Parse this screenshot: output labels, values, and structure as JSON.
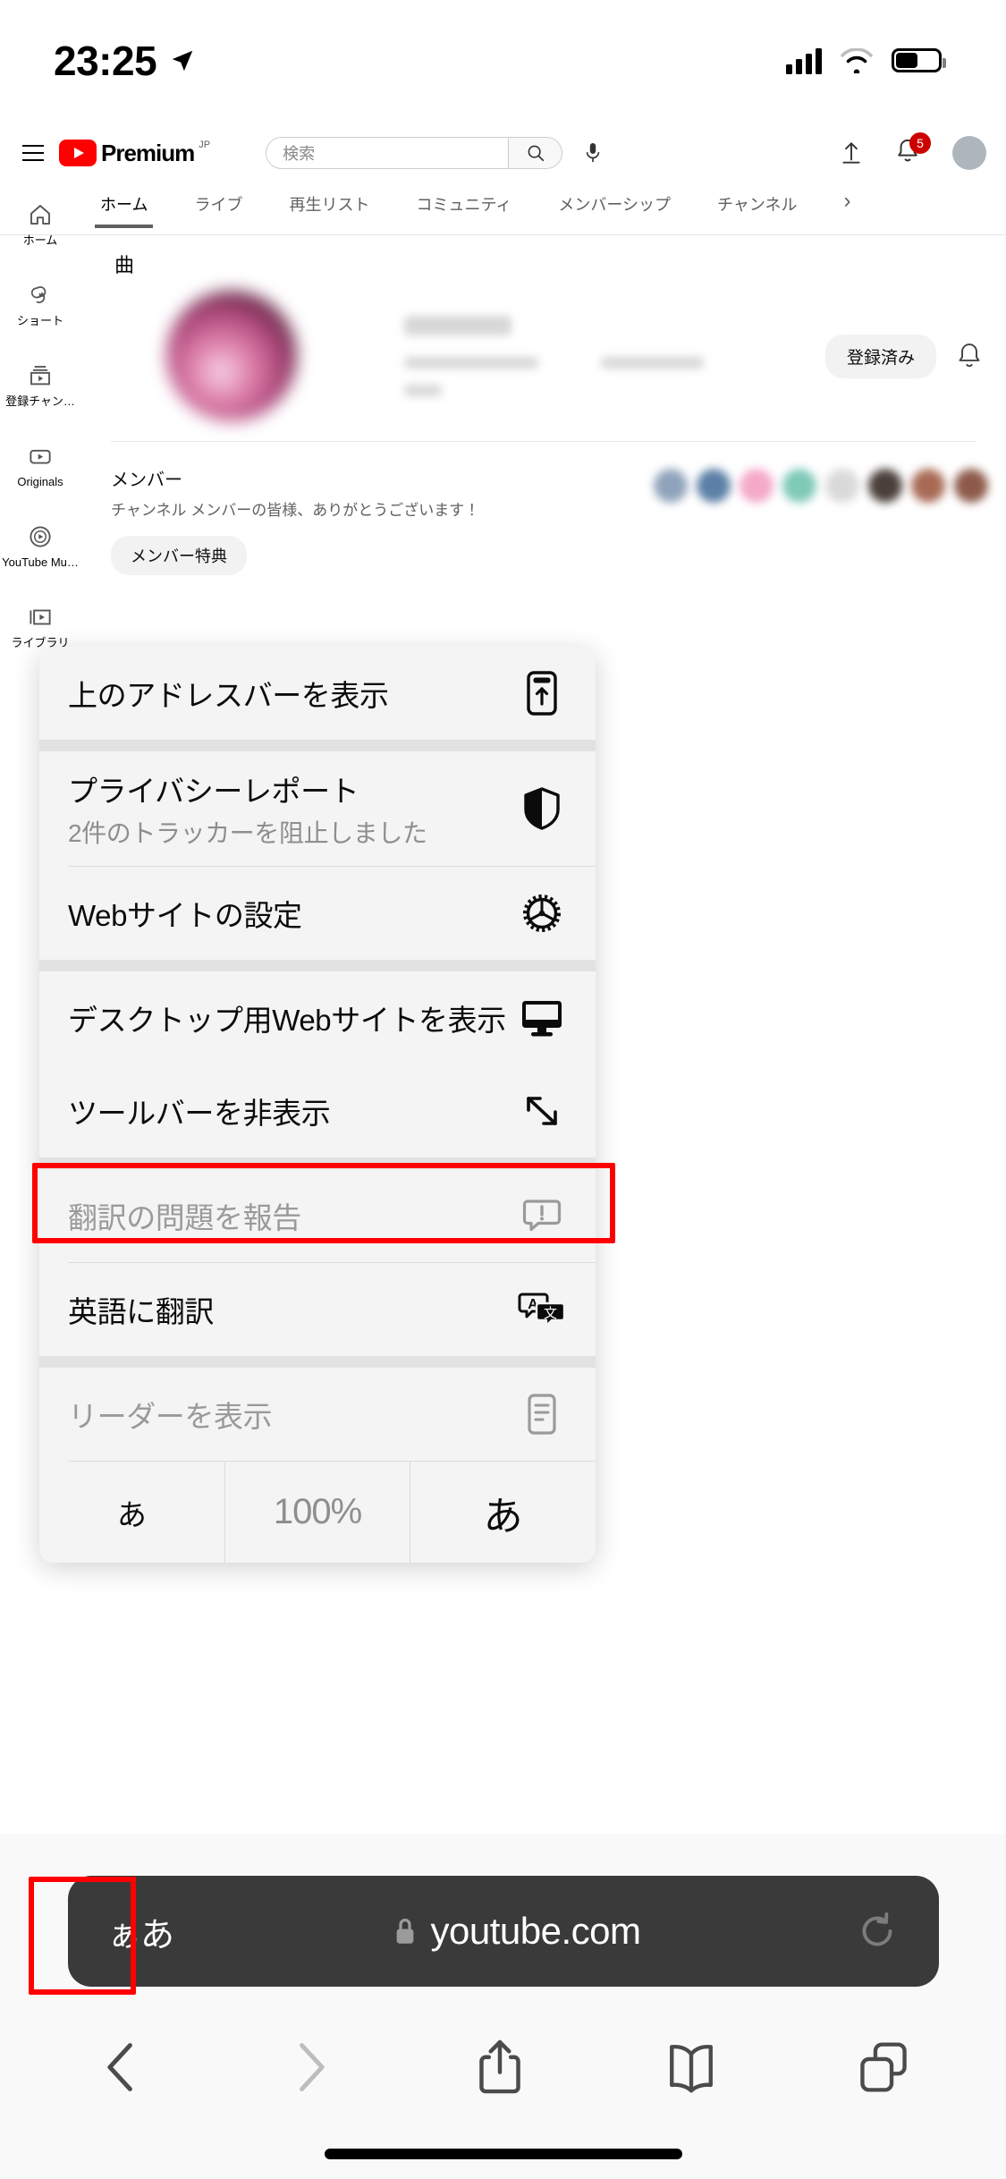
{
  "status_bar": {
    "time": "23:25",
    "location_icon": "location-arrow-icon",
    "cellular_icon": "cellular-signal-icon",
    "wifi_icon": "wifi-icon",
    "battery_icon": "battery-icon"
  },
  "youtube": {
    "menu_icon": "hamburger-menu-icon",
    "logo_text": "Premium",
    "logo_superscript": "JP",
    "search": {
      "placeholder": "検索",
      "search_icon": "search-icon",
      "mic_icon": "microphone-icon"
    },
    "actions": {
      "upload_icon": "upload-icon",
      "bell_icon": "notifications-bell-icon",
      "notification_count": "5",
      "avatar": "user-avatar"
    },
    "tabs": [
      {
        "label": "ホーム",
        "active": true
      },
      {
        "label": "ライブ",
        "active": false
      },
      {
        "label": "再生リスト",
        "active": false
      },
      {
        "label": "コミュニティ",
        "active": false
      },
      {
        "label": "メンバーシップ",
        "active": false
      },
      {
        "label": "チャンネル",
        "active": false
      }
    ],
    "tabs_more_icon": "chevron-right-icon",
    "rail": [
      {
        "label": "ホーム",
        "icon": "home-icon"
      },
      {
        "label": "ショート",
        "icon": "shorts-icon"
      },
      {
        "label": "登録チャン…",
        "icon": "subscriptions-icon"
      },
      {
        "label": "Originals",
        "icon": "originals-icon"
      },
      {
        "label": "YouTube Mu…",
        "icon": "youtube-music-icon"
      },
      {
        "label": "ライブラリ",
        "icon": "library-icon"
      }
    ],
    "channel": {
      "songs_icon": "music-grid-icon",
      "subscribe_label": "登録済み",
      "bell_icon": "channel-bell-icon"
    },
    "members": {
      "title": "メンバー",
      "subtitle": "チャンネル メンバーの皆様、ありがとうございます！",
      "perks_label": "メンバー特典",
      "avatar_colors": [
        "#8fa4bb",
        "#5b7fa6",
        "#f4a9c8",
        "#7fc9b8",
        "#d9d9d9",
        "#4a3f3a",
        "#a86a55",
        "#8d5a4a"
      ]
    }
  },
  "context_menu": {
    "rows": [
      {
        "id": "show-address-bar",
        "title": "上のアドレスバーを表示",
        "subtitle": "",
        "icon": "address-bar-top-icon",
        "disabled": false,
        "highlighted": false
      },
      {
        "id": "privacy-report",
        "title": "プライバシーレポート",
        "subtitle": "2件のトラッカーを阻止しました",
        "icon": "shield-icon",
        "disabled": false,
        "highlighted": false
      },
      {
        "id": "website-settings",
        "title": "Webサイトの設定",
        "subtitle": "",
        "icon": "gear-icon",
        "disabled": false,
        "highlighted": false
      },
      {
        "id": "request-desktop-site",
        "title": "デスクトップ用Webサイトを表示",
        "subtitle": "",
        "icon": "desktop-monitor-icon",
        "disabled": false,
        "highlighted": true
      },
      {
        "id": "hide-toolbar",
        "title": "ツールバーを非表示",
        "subtitle": "",
        "icon": "expand-diagonal-icon",
        "disabled": false,
        "highlighted": false
      },
      {
        "id": "report-translation-issue",
        "title": "翻訳の問題を報告",
        "subtitle": "",
        "icon": "speech-bubble-exclamation-icon",
        "disabled": true,
        "highlighted": false
      },
      {
        "id": "translate-to-english",
        "title": "英語に翻訳",
        "subtitle": "",
        "icon": "translate-icon",
        "disabled": false,
        "highlighted": false
      },
      {
        "id": "show-reader",
        "title": "リーダーを表示",
        "subtitle": "",
        "icon": "reader-document-icon",
        "disabled": true,
        "highlighted": false
      }
    ],
    "zoom_row": {
      "decrease_label": "あ",
      "value": "100%",
      "increase_label": "あ"
    }
  },
  "safari_bottom": {
    "aa_label": "ぁあ",
    "lock_icon": "lock-icon",
    "url": "youtube.com",
    "reload_icon": "reload-icon",
    "nav": [
      {
        "id": "back",
        "icon": "chevron-left-icon",
        "disabled": false
      },
      {
        "id": "forward",
        "icon": "chevron-right-icon",
        "disabled": true
      },
      {
        "id": "share",
        "icon": "share-icon",
        "disabled": false
      },
      {
        "id": "bookmarks",
        "icon": "book-icon",
        "disabled": false
      },
      {
        "id": "tabs",
        "icon": "tabs-icon",
        "disabled": false
      }
    ]
  },
  "annotations": {
    "highlight_color": "#ff0000",
    "boxes": [
      "request-desktop-site-row",
      "aa-button"
    ]
  }
}
